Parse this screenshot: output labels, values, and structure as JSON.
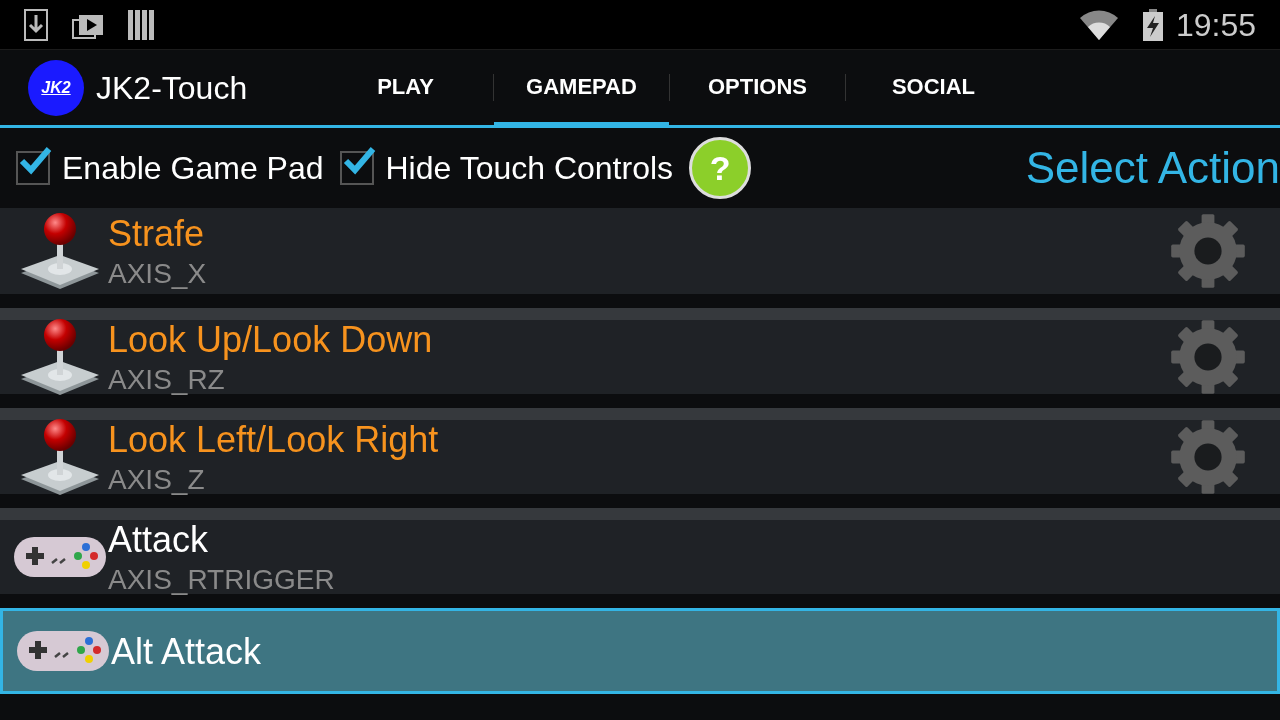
{
  "status_bar": {
    "time": "19:55"
  },
  "action_bar": {
    "logo": "JK2",
    "title": "JK2-Touch"
  },
  "tabs": [
    {
      "label": "PLAY",
      "selected": false
    },
    {
      "label": "GAMEPAD",
      "selected": true
    },
    {
      "label": "OPTIONS",
      "selected": false
    },
    {
      "label": "SOCIAL",
      "selected": false
    }
  ],
  "options": [
    {
      "label": "Enable Game Pad",
      "checked": true
    },
    {
      "label": "Hide Touch Controls",
      "checked": true
    }
  ],
  "help_button": "?",
  "header": "Select Action",
  "actions": [
    {
      "kind": "axis",
      "title": "Strafe",
      "binding": "AXIS_X",
      "selected": false
    },
    {
      "kind": "axis",
      "title": "Look Up/Look Down",
      "binding": "AXIS_RZ",
      "selected": false
    },
    {
      "kind": "axis",
      "title": "Look Left/Look Right",
      "binding": "AXIS_Z",
      "selected": false
    },
    {
      "kind": "button",
      "title": "Attack",
      "binding": "AXIS_RTRIGGER",
      "selected": false
    },
    {
      "kind": "button",
      "title": "Alt Attack",
      "selected": true
    }
  ]
}
